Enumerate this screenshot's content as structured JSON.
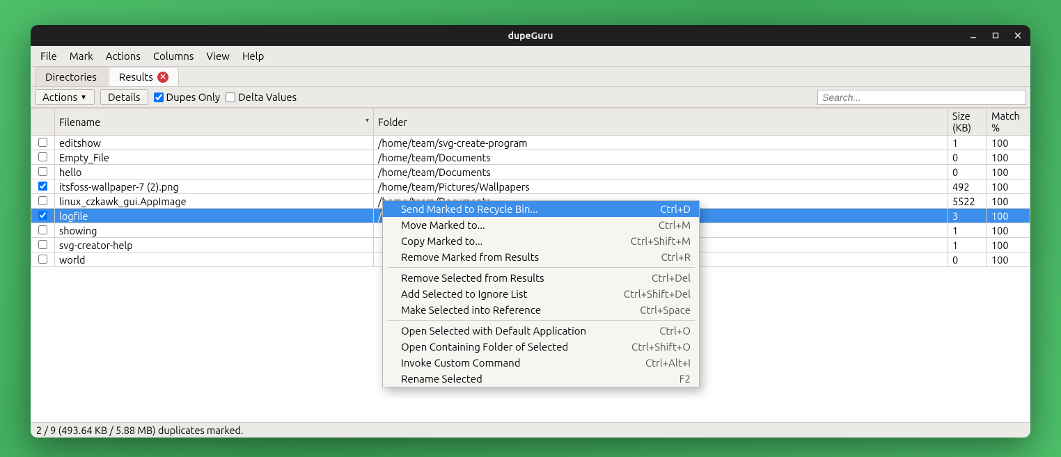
{
  "title": "dupeGuru",
  "menubar": [
    "File",
    "Mark",
    "Actions",
    "Columns",
    "View",
    "Help"
  ],
  "tabs": [
    {
      "label": "Directories",
      "active": false,
      "closable": false
    },
    {
      "label": "Results",
      "active": true,
      "closable": true
    }
  ],
  "toolbar": {
    "actions_label": "Actions",
    "details_label": "Details",
    "dupes_only": {
      "label": "Dupes Only",
      "checked": true
    },
    "delta_values": {
      "label": "Delta Values",
      "checked": false
    },
    "search_placeholder": "Search..."
  },
  "columns": {
    "filename": "Filename",
    "folder": "Folder",
    "size": "Size (KB)",
    "match": "Match %"
  },
  "rows": [
    {
      "checked": false,
      "filename": "editshow",
      "folder": "/home/team/svg-create-program",
      "size": "1",
      "match": "100",
      "selected": false
    },
    {
      "checked": false,
      "filename": "Empty_File",
      "folder": "/home/team/Documents",
      "size": "0",
      "match": "100",
      "selected": false
    },
    {
      "checked": false,
      "filename": "hello",
      "folder": "/home/team/Documents",
      "size": "0",
      "match": "100",
      "selected": false
    },
    {
      "checked": true,
      "filename": "itsfoss-wallpaper-7 (2).png",
      "folder": "/home/team/Pictures/Wallpapers",
      "size": "492",
      "match": "100",
      "selected": false
    },
    {
      "checked": false,
      "filename": "linux_czkawk_gui.AppImage",
      "folder": "/home/team/Documents",
      "size": "5522",
      "match": "100",
      "selected": false
    },
    {
      "checked": true,
      "filename": "logfile",
      "folder": "/home/team/Pictures",
      "size": "3",
      "match": "100",
      "selected": true
    },
    {
      "checked": false,
      "filename": "showing",
      "folder": "",
      "size": "1",
      "match": "100",
      "selected": false
    },
    {
      "checked": false,
      "filename": "svg-creator-help",
      "folder": "",
      "size": "1",
      "match": "100",
      "selected": false
    },
    {
      "checked": false,
      "filename": "world",
      "folder": "",
      "size": "0",
      "match": "100",
      "selected": false
    }
  ],
  "context_menu": [
    {
      "label": "Send Marked to Recycle Bin...",
      "shortcut": "Ctrl+D",
      "highlight": true
    },
    {
      "label": "Move Marked to...",
      "shortcut": "Ctrl+M"
    },
    {
      "label": "Copy Marked to...",
      "shortcut": "Ctrl+Shift+M"
    },
    {
      "label": "Remove Marked from Results",
      "shortcut": "Ctrl+R"
    },
    {
      "sep": true
    },
    {
      "label": "Remove Selected from Results",
      "shortcut": "Ctrl+Del"
    },
    {
      "label": "Add Selected to Ignore List",
      "shortcut": "Ctrl+Shift+Del"
    },
    {
      "label": "Make Selected into Reference",
      "shortcut": "Ctrl+Space"
    },
    {
      "sep": true
    },
    {
      "label": "Open Selected with Default Application",
      "shortcut": "Ctrl+O"
    },
    {
      "label": "Open Containing Folder of Selected",
      "shortcut": "Ctrl+Shift+O"
    },
    {
      "label": "Invoke Custom Command",
      "shortcut": "Ctrl+Alt+I"
    },
    {
      "label": "Rename Selected",
      "shortcut": "F2"
    }
  ],
  "status": "2 / 9 (493.64 KB / 5.88 MB) duplicates marked."
}
